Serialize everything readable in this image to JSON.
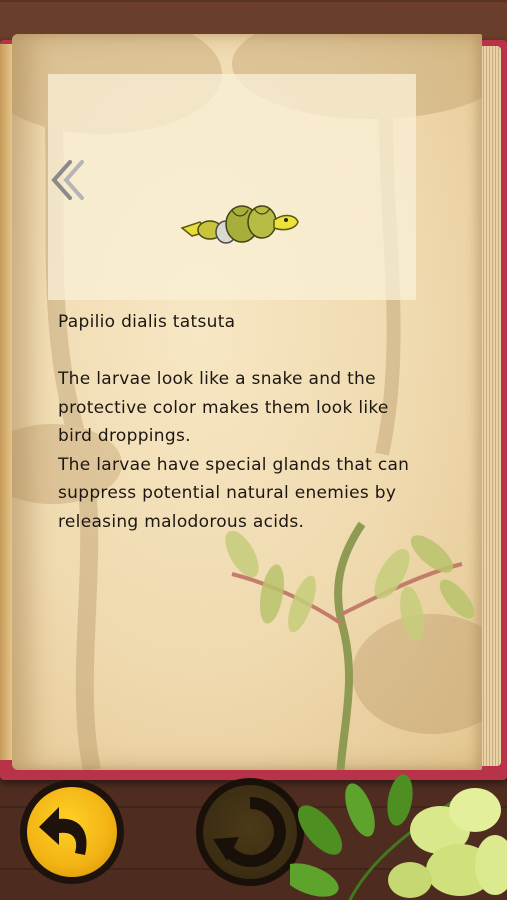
{
  "entry": {
    "species_name": "Papilio dialis tatsuta",
    "description": "The larvae look like a snake and the protective color makes them look like bird droppings.\nThe larvae have special glands that can suppress potential natural enemies by releasing malodorous acids."
  },
  "icons": {
    "previous": "double-chevron-left-icon",
    "larva": "caterpillar-illustration",
    "back": "curved-back-arrow-icon",
    "restart": "circular-arrow-icon"
  },
  "colors": {
    "book_cover": "#b8324a",
    "page": "#f2dfb7",
    "back_button": "#f2b214",
    "restart_button": "#3b2d13",
    "wood": "#5a3325"
  }
}
